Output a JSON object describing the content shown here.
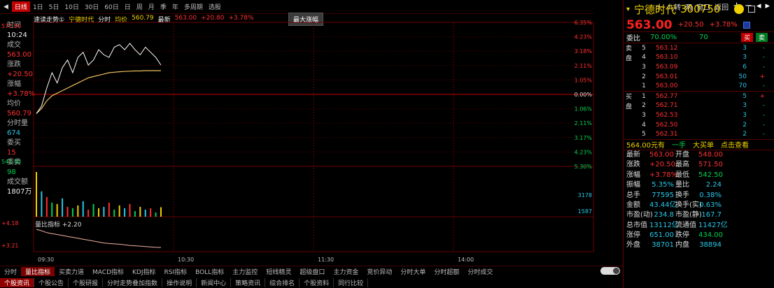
{
  "toolbar": {
    "periods": [
      "日线",
      "1日",
      "5日",
      "10日",
      "30日",
      "60日",
      "日",
      "周",
      "月",
      "季",
      "年",
      "多周期",
      "选股"
    ],
    "active_period": 0,
    "right_items": [
      "十",
      "九转",
      "两",
      "窗口",
      "返回"
    ]
  },
  "info": {
    "title": "速读走势①",
    "stock": "宁德时代",
    "mode1": "分时",
    "mode2": "均价",
    "avg_price": "560.79",
    "latest_label": "最新",
    "latest": "563.00",
    "change": "+20.80",
    "change_pct": "+3.78%"
  },
  "popup": "最大涨幅",
  "left_panel": [
    {
      "label": "时间",
      "value": "10:24"
    },
    {
      "label": "成交",
      "value": "563.00"
    },
    {
      "label": "涨跌",
      "value": "+20.50"
    },
    {
      "label": "涨幅",
      "value": "+3.78%"
    },
    {
      "label": "均价",
      "value": "560.79"
    },
    {
      "label": "分时量",
      "value": "674"
    },
    {
      "label": "委买",
      "value": "15"
    },
    {
      "label": "委卖",
      "value": "98"
    },
    {
      "label": "成交额",
      "value": "1807万"
    }
  ],
  "y_axis_left": [
    "571.50",
    "542.50"
  ],
  "y_axis_right": [
    "6.35%",
    "4.23%",
    "3.18%",
    "2.11%",
    "1.05%",
    "0.00%",
    "1.06%",
    "2.11%",
    "3.17%",
    "4.23%",
    "5.30%"
  ],
  "vol_axis": [
    "3178",
    "1587"
  ],
  "x_axis": [
    "09:30",
    "10:30",
    "11:30",
    "14:00"
  ],
  "indicator": {
    "name": "量比指标",
    "value": "+2.20"
  },
  "indicator_axis": [
    "+4.18",
    "+3.21"
  ],
  "tabs_row1": [
    "分时",
    "量比指标",
    "买卖力道",
    "MACD指标",
    "KDJ指标",
    "RSI指标",
    "BOLL指标",
    "主力监控",
    "短线精灵",
    "超级盘口",
    "主力资金",
    "竞价异动",
    "分时大单",
    "分时超额",
    "分时成交"
  ],
  "tabs_row1_active": 1,
  "tabs_row2": [
    "个股资讯",
    "个股公告",
    "个股研报",
    "分时走势叠加指数",
    "操作说明",
    "新闻中心",
    "策略资讯",
    "综合排名",
    "个股资料",
    "同行比较"
  ],
  "tabs_row2_active": 0,
  "stock": {
    "name": "宁德时代",
    "code": "300750",
    "price": "563.00",
    "change": "+20.50",
    "change_pct": "+3.78%"
  },
  "ratio": {
    "label": "委比",
    "value": "70.00%",
    "diff": "70",
    "buy_btn": "买",
    "sell_btn": "卖"
  },
  "asks": [
    {
      "lvl": "5",
      "price": "563.12",
      "vol": "3",
      "chg": "-"
    },
    {
      "lvl": "4",
      "price": "563.10",
      "vol": "3",
      "chg": "-"
    },
    {
      "lvl": "3",
      "price": "563.09",
      "vol": "6",
      "chg": "-"
    },
    {
      "lvl": "2",
      "price": "563.01",
      "vol": "50",
      "chg": "+"
    },
    {
      "lvl": "1",
      "price": "563.00",
      "vol": "70",
      "chg": "-"
    }
  ],
  "bids": [
    {
      "lvl": "1",
      "price": "562.77",
      "vol": "5",
      "chg": "+"
    },
    {
      "lvl": "2",
      "price": "562.71",
      "vol": "3",
      "chg": "-"
    },
    {
      "lvl": "3",
      "price": "562.53",
      "vol": "3",
      "chg": "-"
    },
    {
      "lvl": "4",
      "price": "562.50",
      "vol": "2",
      "chg": "-"
    },
    {
      "lvl": "5",
      "price": "562.31",
      "vol": "2",
      "chg": "-"
    }
  ],
  "ask_label": "卖盘",
  "bid_label": "买盘",
  "big_order": {
    "text": "564.00元有",
    "amount": "一手",
    "tag": "大买单",
    "hint": "点击查看"
  },
  "stats": [
    [
      "最新",
      "563.00",
      "开盘",
      "548.00"
    ],
    [
      "涨跌",
      "+20.50",
      "最高",
      "571.50"
    ],
    [
      "涨幅",
      "+3.78%",
      "最低",
      "542.50"
    ],
    [
      "振幅",
      "5.35%",
      "量比",
      "2.24"
    ],
    [
      "总手",
      "77595",
      "换手",
      "0.38%"
    ],
    [
      "金额",
      "43.44亿",
      "换手(实)",
      "0.63%"
    ],
    [
      "市盈(动)",
      "234.8",
      "市盈(静)",
      "167.7"
    ],
    [
      "总市值",
      "13112亿",
      "流通值",
      "11427亿"
    ],
    [
      "涨停",
      "651.00",
      "跌停",
      "434.00"
    ],
    [
      "外盘",
      "38701",
      "内盘",
      "38894"
    ]
  ],
  "colors": {
    "up": "#ff3030",
    "down": "#00d050",
    "price_line": "#ffffff",
    "avg_line": "#f0c060",
    "grid": "#6a0000"
  },
  "chart_data": {
    "type": "line",
    "title": "",
    "series": [
      {
        "name": "分时",
        "values": [
          544,
          547,
          554,
          560,
          556,
          562,
          565,
          560,
          566,
          568,
          563,
          565,
          569,
          567,
          566,
          570,
          571,
          569,
          571.5,
          569,
          567,
          570,
          568,
          566,
          563
        ]
      },
      {
        "name": "均价",
        "values": [
          544,
          546,
          549,
          551,
          552,
          553,
          554,
          555,
          556,
          557,
          558,
          558.5,
          559,
          559.5,
          560,
          560.2,
          560.4,
          560.5,
          560.6,
          560.7,
          560.7,
          560.8,
          560.8,
          560.8,
          560.79
        ]
      }
    ],
    "ylim": [
      542.5,
      571.5
    ],
    "volumes": [
      3178,
      1800,
      1400,
      1000,
      900,
      1300,
      700,
      600,
      800,
      1100,
      500,
      900,
      600,
      700,
      1000,
      500,
      800,
      600,
      900,
      400,
      700,
      500,
      600,
      300,
      674
    ],
    "indicator_series": [
      4.18,
      4.1,
      4.0,
      3.95,
      3.9,
      3.85,
      3.8,
      3.75,
      3.7,
      3.65,
      3.6,
      3.55,
      3.5,
      3.45,
      3.42,
      3.4,
      3.38,
      3.35,
      3.32,
      3.3,
      3.28,
      3.26,
      3.24,
      3.22,
      3.21
    ]
  }
}
